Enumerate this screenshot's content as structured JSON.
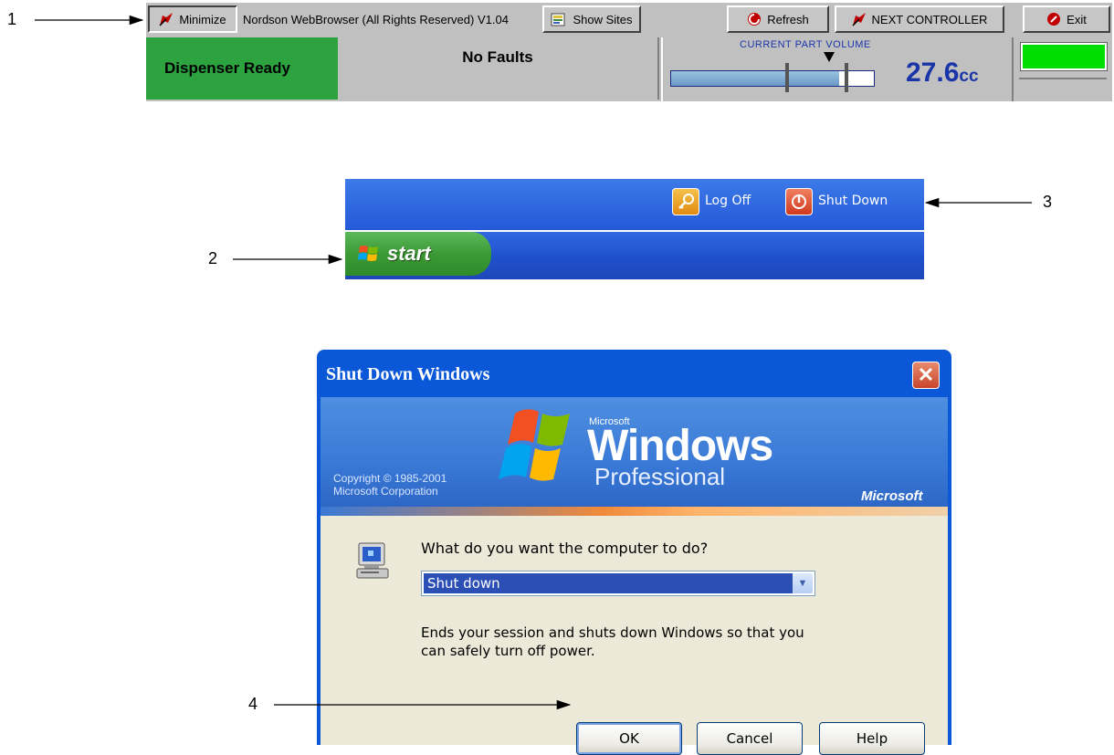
{
  "callouts": {
    "c1": "1",
    "c2": "2",
    "c3": "3",
    "c4": "4"
  },
  "toolbar": {
    "minimize_label": "Minimize",
    "title": "Nordson WebBrowser (All Rights Reserved) V1.04",
    "show_sites_label": "Show Sites",
    "refresh_label": "Refresh",
    "next_controller_label": "NEXT CONTROLLER",
    "exit_label": "Exit"
  },
  "status": {
    "state": "Dispenser Ready",
    "faults": "No Faults",
    "ready_color": "#2ca33e",
    "lamp_color": "#00dd00"
  },
  "volume": {
    "label": "CURRENT PART VOLUME",
    "value": "27.6",
    "unit": "cc",
    "fill_fraction": 0.83
  },
  "taskbar": {
    "log_off_label": "Log Off",
    "shut_down_label": "Shut Down",
    "start_label": "start"
  },
  "dialog": {
    "title": "Shut Down Windows",
    "copyright_line1": "Copyright © 1985-2001",
    "copyright_line2": "Microsoft Corporation",
    "brand_small": "Microsoft",
    "brand_windows": "Windows",
    "brand_edition": "Professional",
    "brand_microsoft": "Microsoft",
    "question": "What do you want the computer to do?",
    "selected_option": "Shut down",
    "description": "Ends your session and shuts down Windows so that you can safely turn off power.",
    "ok_label": "OK",
    "cancel_label": "Cancel",
    "help_label": "Help"
  }
}
